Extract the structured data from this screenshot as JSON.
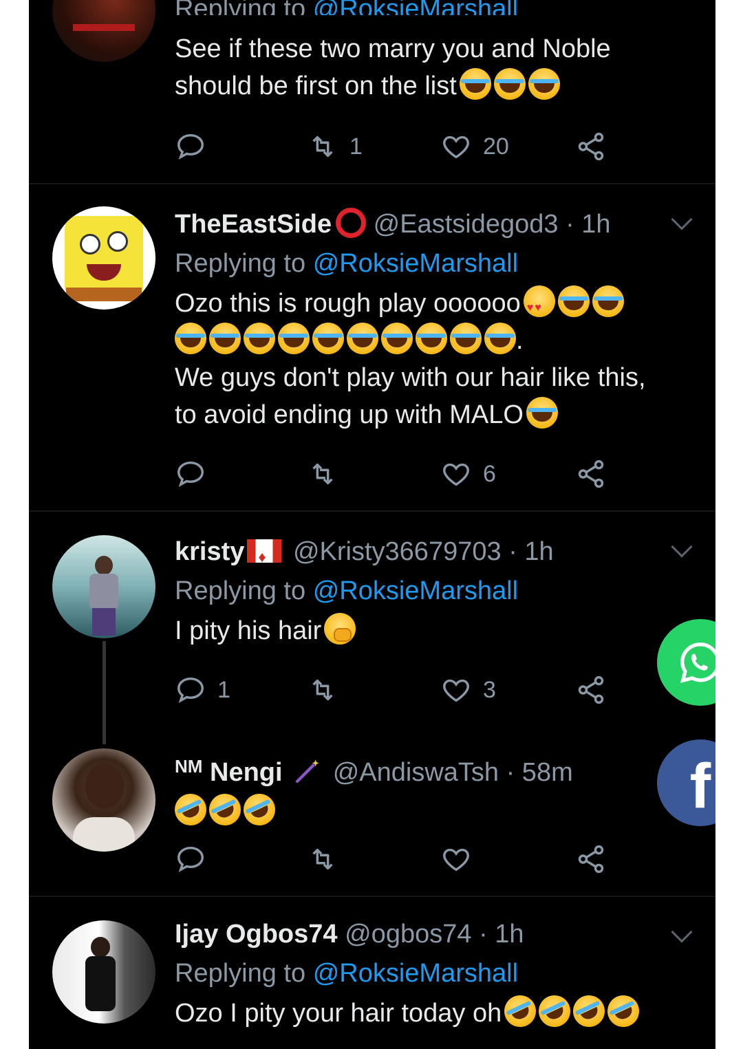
{
  "colors": {
    "background": "#000000",
    "text": "#e7e9ea",
    "muted": "#8b98a5",
    "link": "#1d9bf0",
    "whatsapp": "#25d366",
    "facebook": "#3b5998"
  },
  "tweets": [
    {
      "reply_prefix": "Replying to",
      "reply_handle": "@RoksieMarshall",
      "text_lines": [
        "See if these two marry you and Noble",
        "should be first on the list"
      ],
      "emojis": [
        "face-with-tears-of-joy",
        "face-with-tears-of-joy",
        "face-with-tears-of-joy"
      ],
      "replies": "",
      "retweets": "1",
      "likes": "20"
    },
    {
      "name": "TheEastSide",
      "name_badge": "red-circle",
      "handle": "@Eastsidegod3",
      "time": "· 1h",
      "reply_prefix": "Replying to",
      "reply_handle": "@RoksieMarshall",
      "text_1": "Ozo this is rough play oooooo",
      "text_1_tail": ".",
      "text_2": "We guys don't play with our hair like this,",
      "text_3": "to avoid ending up with MALO",
      "replies": "",
      "retweets": "",
      "likes": "6"
    },
    {
      "name": "kristy",
      "name_badge": "canada-flag",
      "handle": "@Kristy36679703",
      "time": "· 1h",
      "reply_prefix": "Replying to",
      "reply_handle": "@RoksieMarshall",
      "text": "I pity his hair",
      "emoji": "face-with-hand-over-mouth",
      "replies": "1",
      "retweets": "",
      "likes": "3"
    },
    {
      "name_prefix": "NM",
      "name": "Nengi",
      "name_badge": "wand",
      "handle": "@AndiswaTsh",
      "time": "· 58m",
      "emojis": [
        "rolling-on-floor-laughing",
        "rolling-on-floor-laughing",
        "rolling-on-floor-laughing"
      ],
      "replies": "",
      "retweets": "",
      "likes": ""
    },
    {
      "name": "Ijay Ogbos74",
      "handle": "@ogbos74",
      "time": "· 1h",
      "reply_prefix": "Replying to",
      "reply_handle": "@RoksieMarshall",
      "text": "Ozo I pity your hair today oh",
      "emojis": [
        "rolling-on-floor-laughing",
        "rolling-on-floor-laughing",
        "rolling-on-floor-laughing",
        "rolling-on-floor-laughing"
      ]
    }
  ],
  "share_buttons": [
    {
      "icon": "whatsapp-icon",
      "label": ""
    },
    {
      "icon": "facebook-icon",
      "label": "f"
    }
  ]
}
